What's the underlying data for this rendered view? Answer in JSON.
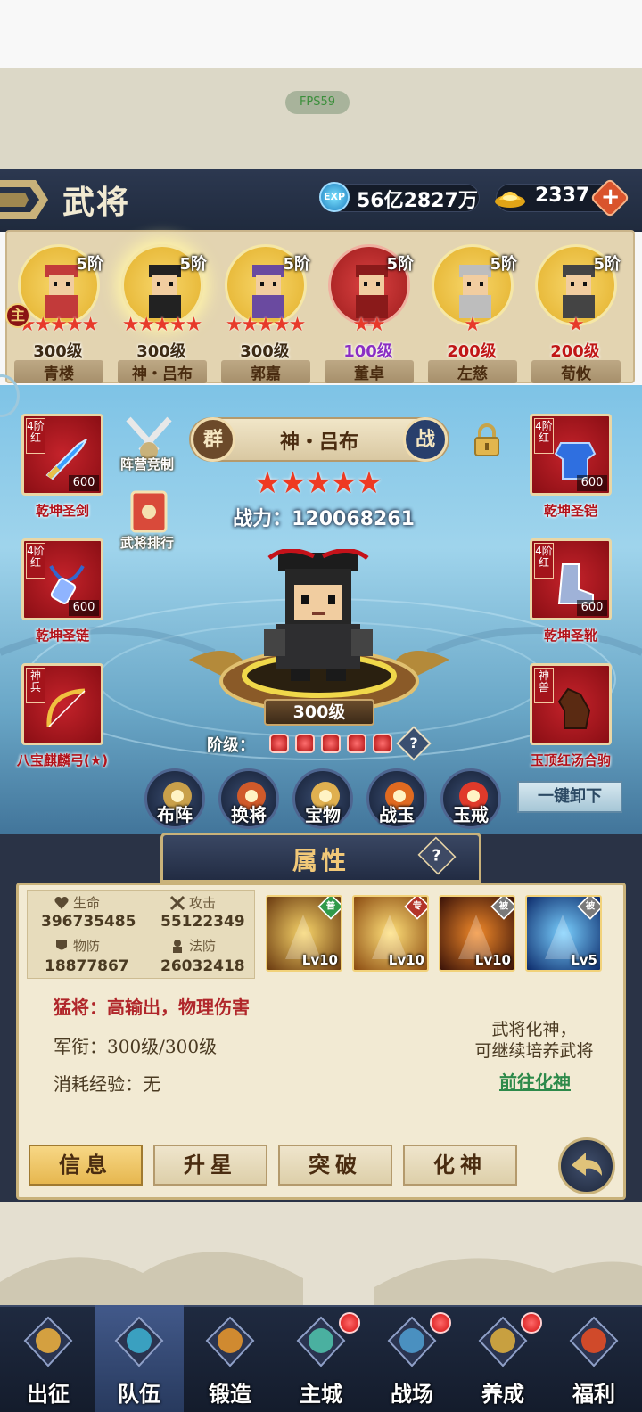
{
  "fps": "FPS59",
  "header": {
    "title": "武将",
    "exp_icon_label": "EXP",
    "exp_value": "56亿2827万",
    "gold_value": "2337",
    "add_label": "+"
  },
  "main_badge": "主",
  "heroes": [
    {
      "rank": "5阶",
      "stars": "★★★★★",
      "level": "300级",
      "level_color": "#3c2a14",
      "name": "青楼",
      "portrait": "gold",
      "selected": false
    },
    {
      "rank": "5阶",
      "stars": "★★★★★",
      "level": "300级",
      "level_color": "#3c2a14",
      "name": "神・吕布",
      "portrait": "gold",
      "selected": true
    },
    {
      "rank": "5阶",
      "stars": "★★★★★",
      "level": "300级",
      "level_color": "#3c2a14",
      "name": "郭嘉",
      "portrait": "gold",
      "selected": false
    },
    {
      "rank": "5阶",
      "stars": "★★",
      "level": "100级",
      "level_color": "#8a2ec4",
      "name": "董卓",
      "portrait": "red",
      "selected": false
    },
    {
      "rank": "5阶",
      "stars": "★",
      "level": "200级",
      "level_color": "#c01616",
      "name": "左慈",
      "portrait": "gold",
      "selected": false
    },
    {
      "rank": "5阶",
      "stars": "★",
      "level": "200级",
      "level_color": "#c01616",
      "name": "荀攸",
      "portrait": "gold",
      "selected": false
    }
  ],
  "equipment": {
    "sword": {
      "tag": "4阶红",
      "count": "600",
      "name": "乾坤圣剑"
    },
    "chain": {
      "tag": "4阶红",
      "count": "600",
      "name": "乾坤圣链"
    },
    "bow": {
      "tag": "神兵",
      "name": "八宝麒麟弓(★)"
    },
    "armor": {
      "tag": "4阶红",
      "count": "600",
      "name": "乾坤圣铠"
    },
    "boots": {
      "tag": "4阶红",
      "count": "600",
      "name": "乾坤圣靴"
    },
    "horse": {
      "tag": "神兽",
      "name": "玉顶红汤合驹"
    }
  },
  "side_buttons": {
    "formation_contest": "阵营竞制",
    "general_rank": "武将排行"
  },
  "general": {
    "faction": "群",
    "name": "神・吕布",
    "battle_tag": "战",
    "stars": "★★★★★",
    "power": "战力：120068261",
    "level": "300级",
    "tier_label": "阶级："
  },
  "actions": [
    {
      "label": "布阵",
      "icon": "formation-icon"
    },
    {
      "label": "换将",
      "icon": "swap-general-icon"
    },
    {
      "label": "宝物",
      "icon": "treasure-icon"
    },
    {
      "label": "战玉",
      "icon": "battle-jade-icon"
    },
    {
      "label": "玉戒",
      "icon": "jade-ring-icon"
    }
  ],
  "unequip_label": "一键卸下",
  "attributes": {
    "title": "属性",
    "hp_label": "生命",
    "hp_value": "396735485",
    "atk_label": "攻击",
    "atk_value": "55122349",
    "pdef_label": "物防",
    "pdef_value": "18877867",
    "mdef_label": "法防",
    "mdef_value": "26032418",
    "skills": [
      {
        "level": "Lv10",
        "badge": "普",
        "badge_color": "#2f9a4a"
      },
      {
        "level": "Lv10",
        "badge": "专",
        "badge_color": "#b3342a"
      },
      {
        "level": "Lv10",
        "badge": "被",
        "badge_color": "#7a7a7a"
      },
      {
        "level": "Lv5",
        "badge": "被",
        "badge_color": "#7a7a7a"
      }
    ],
    "type_text": "猛将：高输出，物理伤害",
    "rank_text": "军衔：300级/300级",
    "exp_cost_text": "消耗经验：无",
    "deify_line1": "武将化神，",
    "deify_line2": "可继续培养武将",
    "deify_link": "前往化神"
  },
  "tabs": [
    "信息",
    "升星",
    "突破",
    "化神"
  ],
  "bottom_nav": [
    {
      "label": "出征",
      "dot": false,
      "active": false
    },
    {
      "label": "队伍",
      "dot": false,
      "active": true
    },
    {
      "label": "锻造",
      "dot": false,
      "active": false
    },
    {
      "label": "主城",
      "dot": true,
      "active": false
    },
    {
      "label": "战场",
      "dot": true,
      "active": false
    },
    {
      "label": "养成",
      "dot": true,
      "active": false
    },
    {
      "label": "福利",
      "dot": false,
      "active": false
    }
  ]
}
